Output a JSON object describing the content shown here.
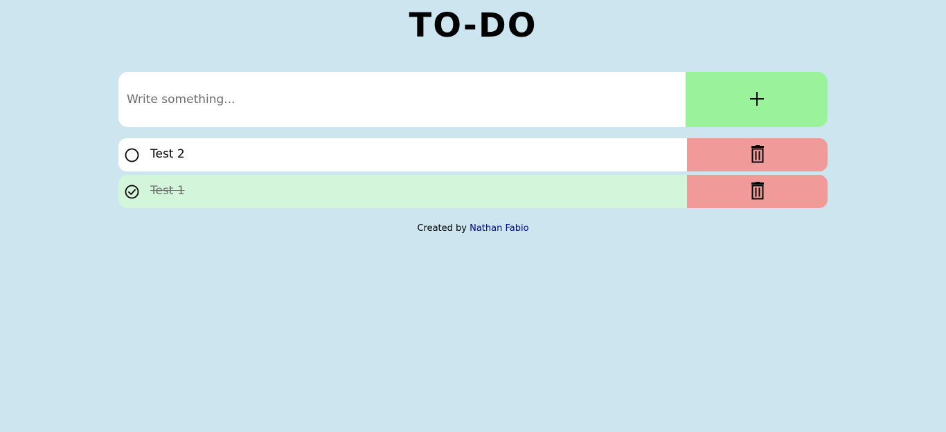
{
  "header": {
    "title": "TO-DO"
  },
  "add_form": {
    "input_value": "",
    "input_placeholder": "Write something...",
    "add_icon": "plus-icon"
  },
  "todos": [
    {
      "text": "Test 2",
      "completed": false,
      "check_icon": "circle-icon",
      "delete_icon": "trash-icon"
    },
    {
      "text": "Test 1",
      "completed": true,
      "check_icon": "check-circle-icon",
      "delete_icon": "trash-icon"
    }
  ],
  "footer": {
    "prefix": "Created by",
    "author": "Nathan Fabio"
  },
  "colors": {
    "background": "#cde5ef",
    "add_button": "#9af29a",
    "delete_button": "#f09a9a",
    "completed_item": "#d3f5d9",
    "link": "#0000a0"
  }
}
